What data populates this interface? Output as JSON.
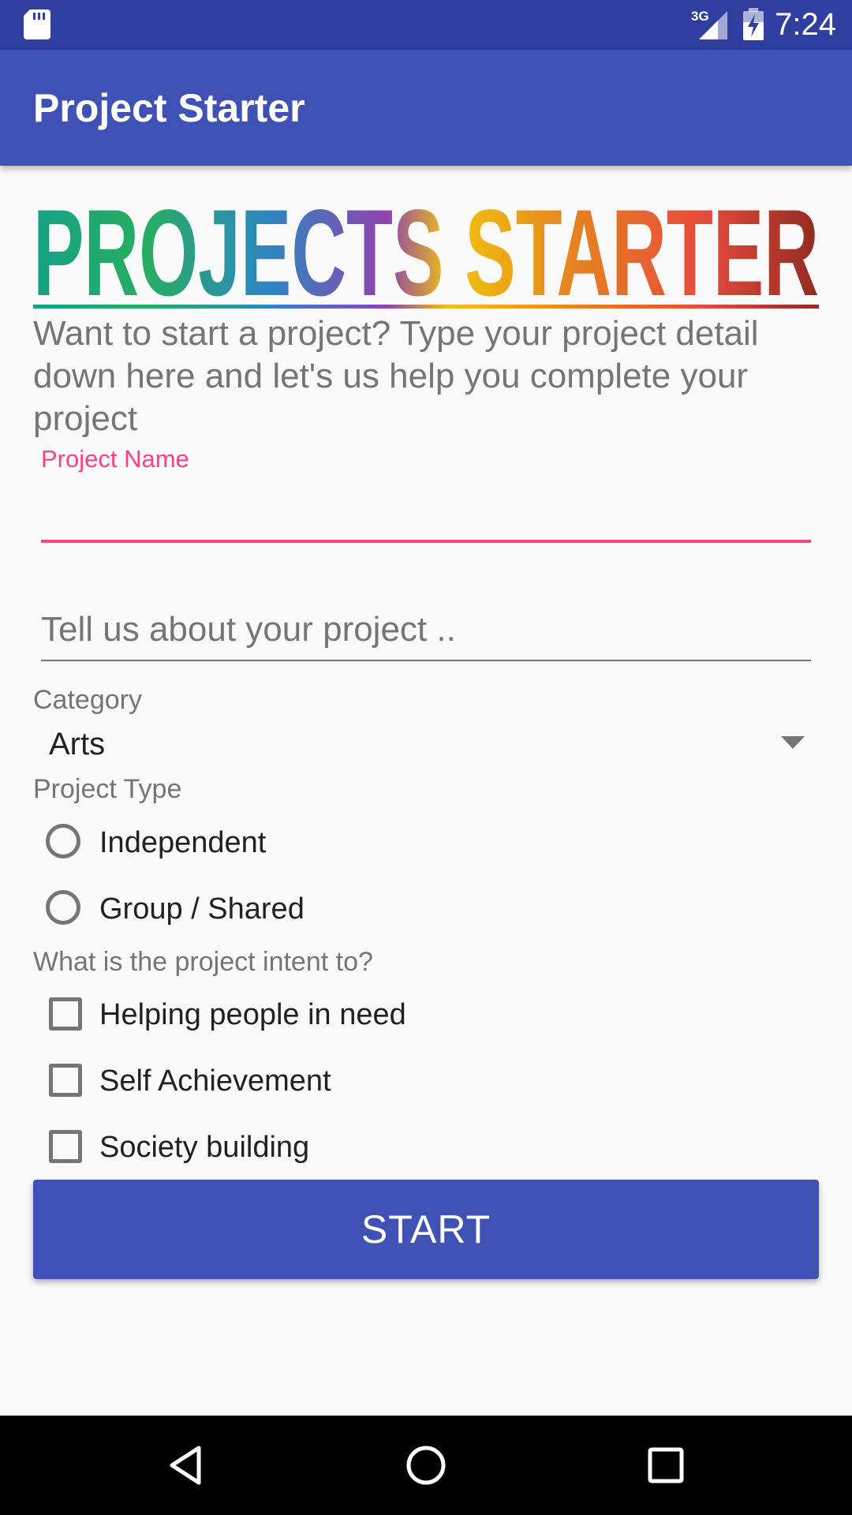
{
  "status_bar": {
    "time": "7:24",
    "network_label": "3G",
    "icons": [
      "sd-card-icon",
      "signal-icon",
      "battery-charging-icon"
    ]
  },
  "app_bar": {
    "title": "Project Starter"
  },
  "banner": {
    "text": "PROJECTS STARTER",
    "colors": [
      "#16a085",
      "#27ae60",
      "#2e86c1",
      "#8e44ad",
      "#f1c40f",
      "#e67e22",
      "#e74c3c",
      "#922b21"
    ]
  },
  "intro": {
    "text": "Want to start a project? Type your project detail down here and let's us help you complete your project"
  },
  "form": {
    "project_name": {
      "label": "Project Name",
      "value": ""
    },
    "about": {
      "placeholder": "Tell us about your project ..",
      "value": ""
    },
    "category": {
      "label": "Category",
      "selected": "Arts"
    },
    "project_type": {
      "label": "Project Type",
      "options": [
        {
          "label": "Independent",
          "checked": false
        },
        {
          "label": "Group / Shared",
          "checked": false
        }
      ]
    },
    "intent": {
      "label": "What is the project intent to?",
      "options": [
        {
          "label": "Helping people in need",
          "checked": false
        },
        {
          "label": "Self Achievement",
          "checked": false
        },
        {
          "label": "Society building",
          "checked": false
        }
      ]
    },
    "start_label": "START"
  },
  "nav": {
    "icons": [
      "back-icon",
      "home-icon",
      "recents-icon"
    ]
  },
  "colors": {
    "primary": "#3f51b5",
    "primary_dark": "#303f9f",
    "accent": "#ff4081"
  }
}
